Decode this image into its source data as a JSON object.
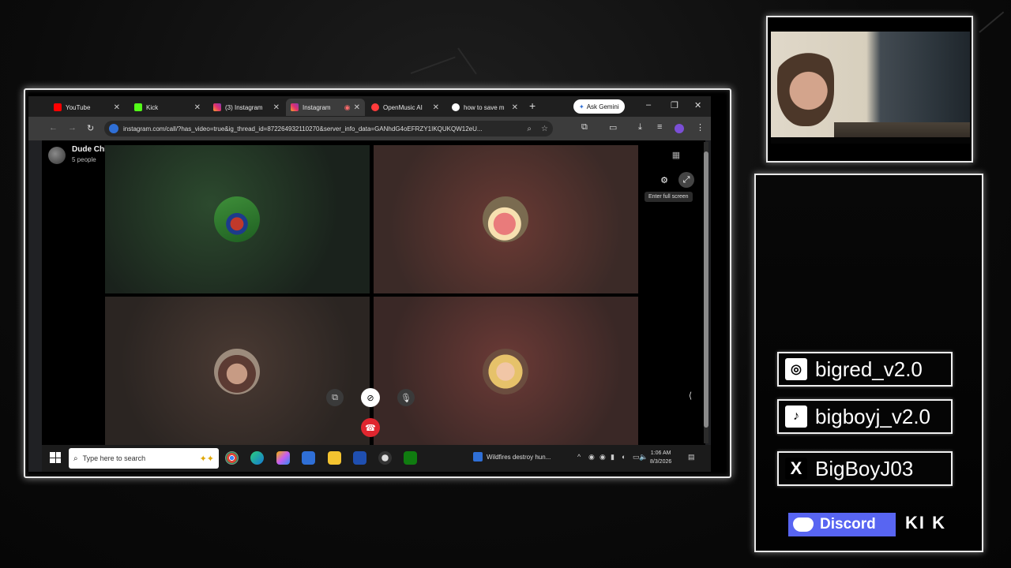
{
  "tabs": [
    {
      "label": "YouTube",
      "icon": "youtube-icon",
      "color": "#ff0000"
    },
    {
      "label": "Kick",
      "icon": "kick-icon",
      "color": "#53fc18"
    },
    {
      "label": "(3) Instagram",
      "icon": "instagram-icon",
      "color": "#e1306c"
    },
    {
      "label": "Instagram",
      "icon": "instagram-icon",
      "color": "#e1306c",
      "active": true
    },
    {
      "label": "OpenMusic AI",
      "icon": "openmusic-icon",
      "color": "#ff3b3b"
    },
    {
      "label": "how to save m",
      "icon": "google-icon",
      "color": "#ffffff"
    }
  ],
  "toolbar": {
    "ask_gemini": "Ask Gemini",
    "url": "instagram.com/call/?has_video=true&ig_thread_id=872264932110270&server_info_data=GANhdG4oEFRZY1IKQUKQW12eU..."
  },
  "call": {
    "group_name": "Dude Chill Just Chill",
    "participants": "5 people",
    "tooltip": "Enter full screen",
    "tile_colors": [
      "#1f2d22",
      "#4a2b2a",
      "#3a2f2c",
      "#4a2d2c"
    ]
  },
  "taskbar": {
    "search_placeholder": "Type here to search",
    "news": "Wildfires destroy hun...",
    "time": "1:06 AM",
    "date": "8/3/2026"
  },
  "socials": {
    "instagram": "bigred_v2.0",
    "tiktok": "bigboyj_v2.0",
    "x": "BigBoyJ03",
    "discord": "Discord",
    "kick": "KI K"
  }
}
